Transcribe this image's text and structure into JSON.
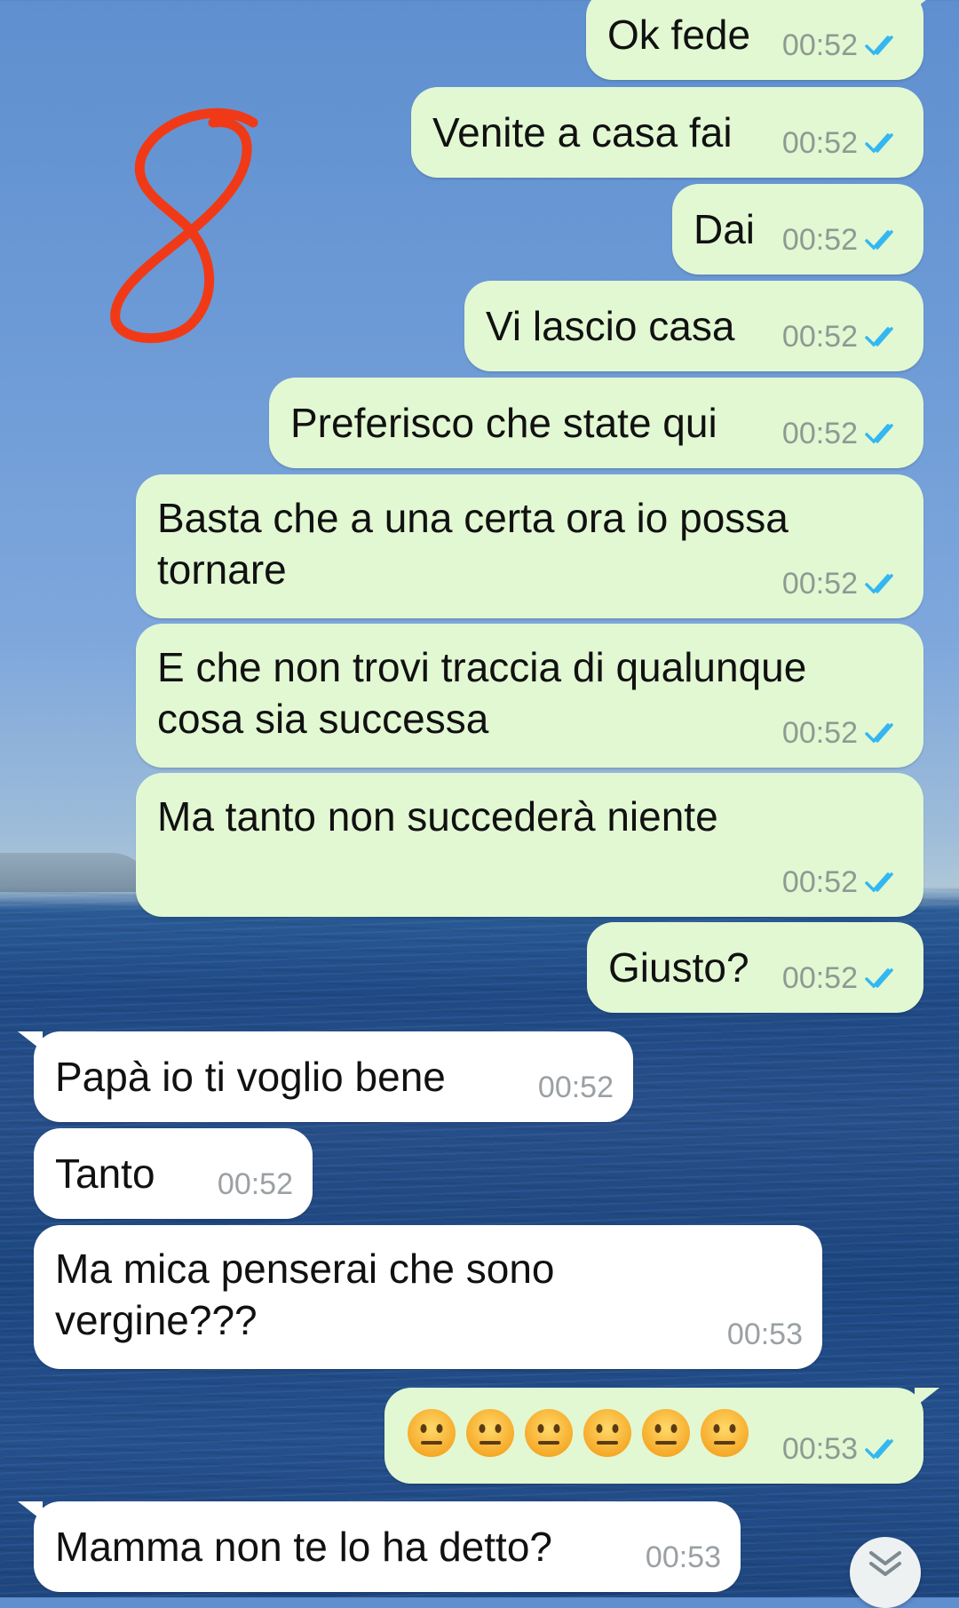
{
  "colors": {
    "outgoing_bubble": "#e2f8d3",
    "incoming_bubble": "#ffffff",
    "read_ticks": "#34b7f1",
    "annotation": "#f03a17"
  },
  "annotation_icon": "handwritten-number-8",
  "messages": [
    {
      "text": "Ok fede",
      "time": "00:52",
      "direction": "out",
      "status": "read"
    },
    {
      "text": "Venite a casa fai",
      "time": "00:52",
      "direction": "out",
      "status": "read"
    },
    {
      "text": "Dai",
      "time": "00:52",
      "direction": "out",
      "status": "read"
    },
    {
      "text": "Vi lascio casa",
      "time": "00:52",
      "direction": "out",
      "status": "read"
    },
    {
      "text": "Preferisco che state qui",
      "time": "00:52",
      "direction": "out",
      "status": "read"
    },
    {
      "text": "Basta che a una certa ora io possa\ntornare",
      "time": "00:52",
      "direction": "out",
      "status": "read"
    },
    {
      "text": "E che non trovi traccia di qualunque\ncosa sia successa",
      "time": "00:52",
      "direction": "out",
      "status": "read"
    },
    {
      "text": "Ma tanto non succederà niente",
      "time": "00:52",
      "direction": "out",
      "status": "read"
    },
    {
      "text": "Giusto?",
      "time": "00:52",
      "direction": "out",
      "status": "read"
    },
    {
      "text": "Papà io ti voglio bene",
      "time": "00:52",
      "direction": "in"
    },
    {
      "text": "Tanto",
      "time": "00:52",
      "direction": "in"
    },
    {
      "text": "Ma mica penserai che sono\nvergine???",
      "time": "00:53",
      "direction": "in"
    },
    {
      "emoji": "neutral-face",
      "emoji_count": 6,
      "time": "00:53",
      "direction": "out",
      "status": "read"
    },
    {
      "text": "Mamma non te lo ha detto?",
      "time": "00:53",
      "direction": "in"
    }
  ],
  "scroll_button_icon": "double-chevron-down-icon"
}
